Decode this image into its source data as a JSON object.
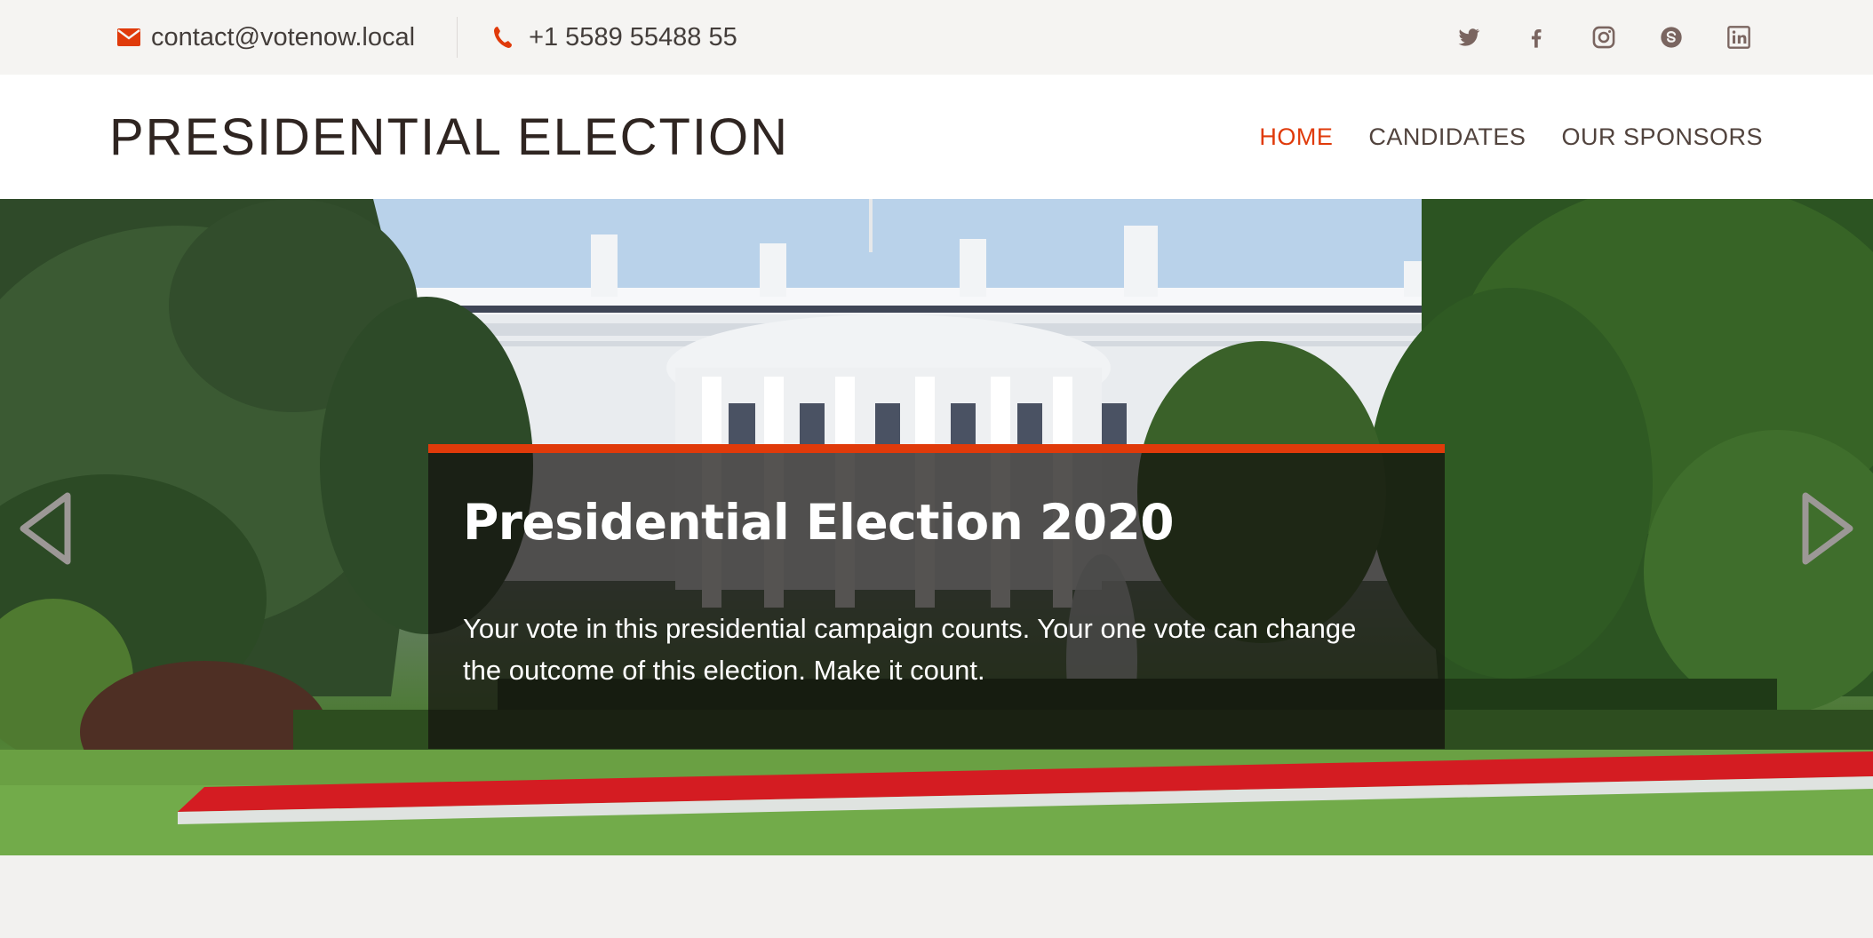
{
  "topbar": {
    "email": "contact@votenow.local",
    "phone": "+1 5589 55488 55",
    "accent_color": "#e03a0a",
    "social_icons": [
      "twitter-icon",
      "facebook-icon",
      "instagram-icon",
      "skype-icon",
      "linkedin-icon"
    ]
  },
  "header": {
    "site_title": "PRESIDENTIAL ELECTION",
    "nav": {
      "home": "HOME",
      "candidates": "CANDIDATES",
      "sponsors": "OUR SPONSORS"
    },
    "active_nav": "HOME"
  },
  "hero": {
    "title": "Presidential Election 2020",
    "text": "Your vote in this presidential campaign counts. Your one vote can change the outcome of this election. Make it count.",
    "prev_icon": "chevron-left-icon",
    "next_icon": "chevron-right-icon"
  }
}
